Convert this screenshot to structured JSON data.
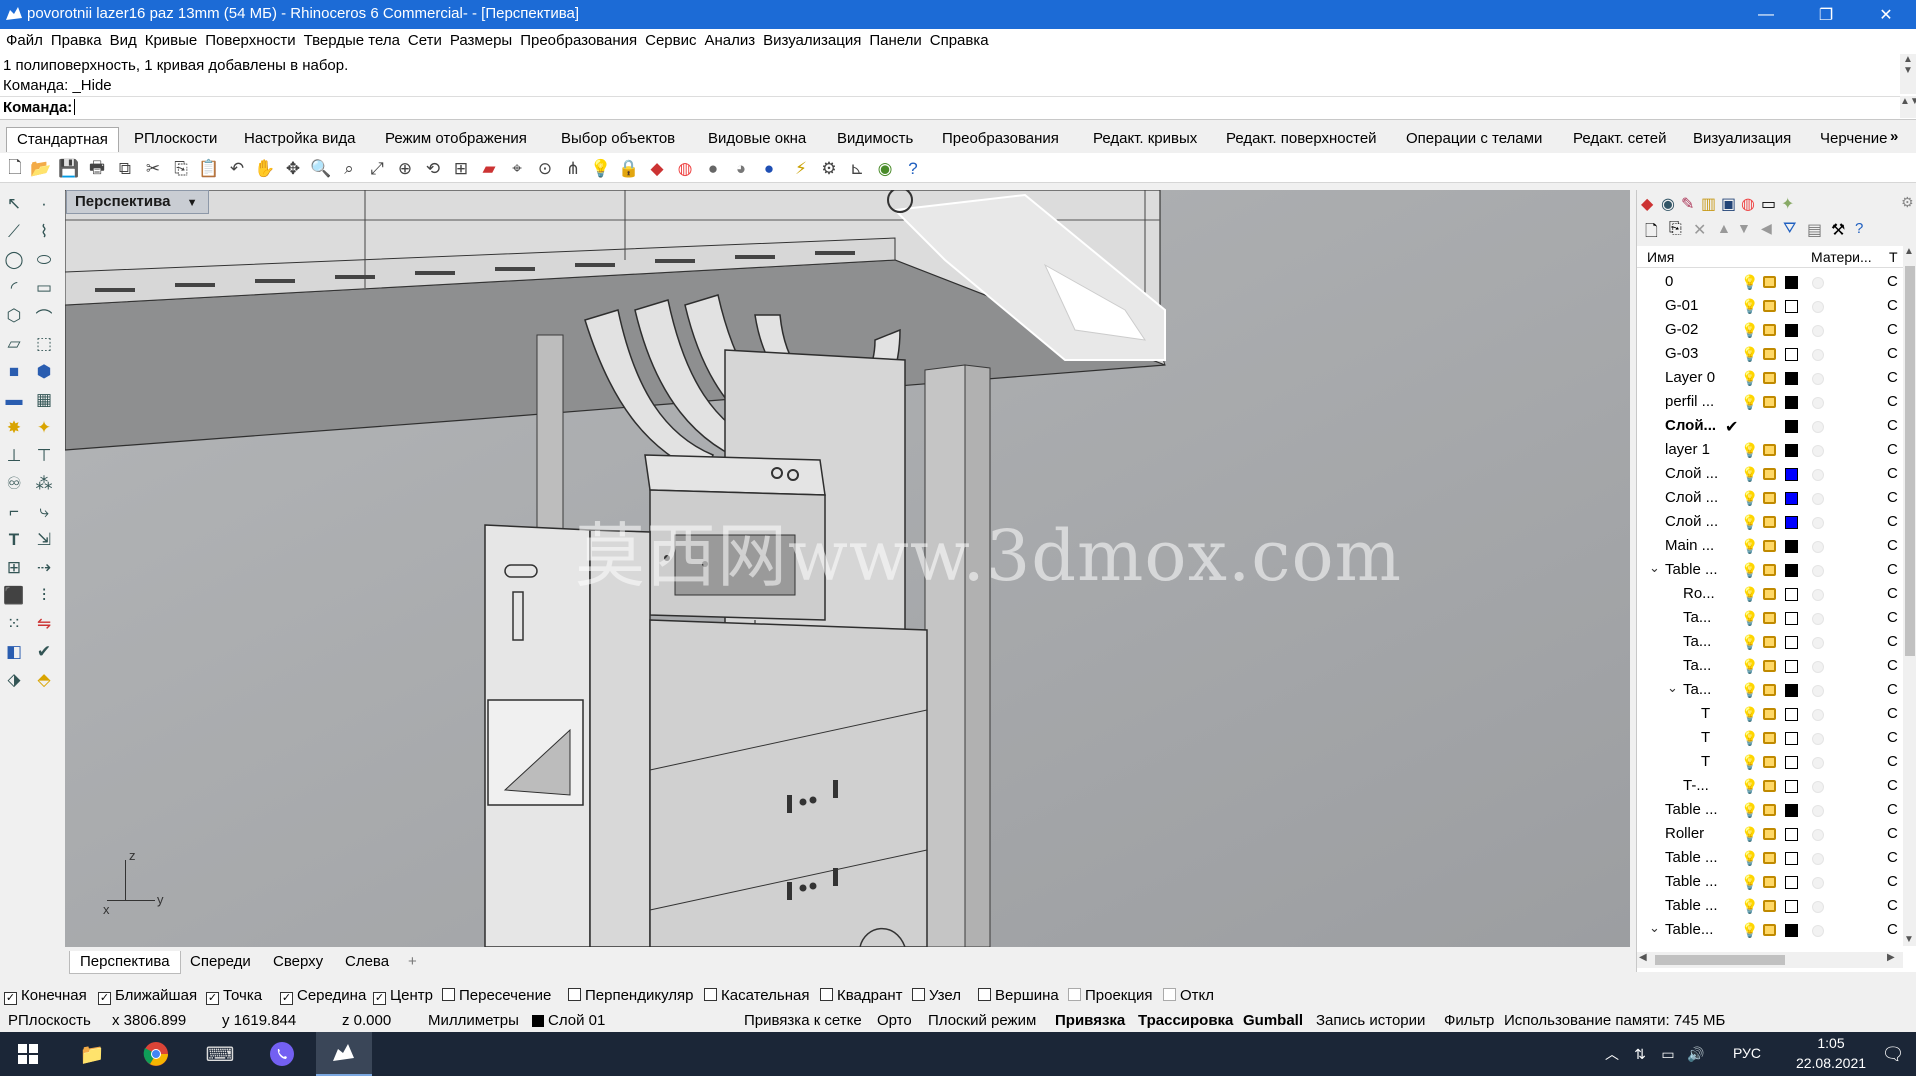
{
  "window": {
    "title": "povorotnii lazer16 paz 13mm (54 МБ) - Rhinoceros 6 Commercial- - [Перспектива]",
    "minimize_glyph": "—",
    "maximize_glyph": "❐",
    "close_glyph": "✕"
  },
  "menu": [
    "Файл",
    "Правка",
    "Вид",
    "Кривые",
    "Поверхности",
    "Твердые тела",
    "Сети",
    "Размеры",
    "Преобразования",
    "Сервис",
    "Анализ",
    "Визуализация",
    "Панели",
    "Справка"
  ],
  "command": {
    "history_1": "1 полиповерхность, 1 кривая добавлены в набор.",
    "history_2": "Команда: _Hide",
    "prompt_label": "Команда:",
    "input_value": ""
  },
  "toolbar_tabs": [
    "Стандартная",
    "РПлоскости",
    "Настройка вида",
    "Режим отображения",
    "Выбор объектов",
    "Видовые окна",
    "Видимость",
    "Преобразования",
    "Редакт. кривых",
    "Редакт. поверхностей",
    "Операции с телами",
    "Редакт. сетей",
    "Визуализация",
    "Черчение"
  ],
  "toolbar_overflow": "»",
  "viewport": {
    "title": "Перспектива",
    "axis_z": "z",
    "axis_x": "x",
    "axis_y": "y",
    "watermark": "莫西网www.3dmox.com"
  },
  "viewport_tabs": [
    "Перспектива",
    "Спереди",
    "Сверху",
    "Слева"
  ],
  "viewport_tab_add": "+",
  "layers": {
    "col_name": "Имя",
    "col_material": "Матери...",
    "col_t": "Т",
    "rows": [
      {
        "name": "0",
        "indent": 0,
        "color": "#000000",
        "current": false
      },
      {
        "name": "G-01",
        "indent": 0,
        "color": "#ffffff",
        "current": false
      },
      {
        "name": "G-02",
        "indent": 0,
        "color": "#000000",
        "current": false
      },
      {
        "name": "G-03",
        "indent": 0,
        "color": "#ffffff",
        "current": false
      },
      {
        "name": "Layer 0",
        "indent": 0,
        "color": "#000000",
        "current": false
      },
      {
        "name": "perfil ...",
        "indent": 0,
        "color": "#000000",
        "current": false
      },
      {
        "name": "Слой...",
        "indent": 0,
        "color": "#000000",
        "current": true
      },
      {
        "name": "layer 1",
        "indent": 0,
        "color": "#000000",
        "current": false
      },
      {
        "name": "Слой ...",
        "indent": 0,
        "color": "#0000ff",
        "current": false
      },
      {
        "name": "Слой ...",
        "indent": 0,
        "color": "#0000ff",
        "current": false
      },
      {
        "name": "Слой ...",
        "indent": 0,
        "color": "#0000ff",
        "current": false
      },
      {
        "name": "Main ...",
        "indent": 0,
        "color": "#000000",
        "current": false
      },
      {
        "name": "Table ...",
        "indent": 0,
        "color": "#000000",
        "current": false,
        "expanded": true
      },
      {
        "name": "Ro...",
        "indent": 1,
        "color": "#ffffff",
        "current": false
      },
      {
        "name": "Ta...",
        "indent": 1,
        "color": "#ffffff",
        "current": false
      },
      {
        "name": "Ta...",
        "indent": 1,
        "color": "#ffffff",
        "current": false
      },
      {
        "name": "Ta...",
        "indent": 1,
        "color": "#ffffff",
        "current": false
      },
      {
        "name": "Ta...",
        "indent": 1,
        "color": "#000000",
        "current": false,
        "expanded": true
      },
      {
        "name": "T",
        "indent": 2,
        "color": "#ffffff",
        "current": false
      },
      {
        "name": "T",
        "indent": 2,
        "color": "#ffffff",
        "current": false
      },
      {
        "name": "T",
        "indent": 2,
        "color": "#ffffff",
        "current": false
      },
      {
        "name": "T-...",
        "indent": 1,
        "color": "#ffffff",
        "current": false
      },
      {
        "name": "Table ...",
        "indent": 0,
        "color": "#000000",
        "current": false
      },
      {
        "name": "Roller",
        "indent": 0,
        "color": "#ffffff",
        "current": false
      },
      {
        "name": "Table ...",
        "indent": 0,
        "color": "#ffffff",
        "current": false
      },
      {
        "name": "Table ...",
        "indent": 0,
        "color": "#ffffff",
        "current": false
      },
      {
        "name": "Table ...",
        "indent": 0,
        "color": "#ffffff",
        "current": false
      },
      {
        "name": "Table...",
        "indent": 0,
        "color": "#000000",
        "current": false,
        "expanded": true
      }
    ],
    "t_value": "С"
  },
  "osnaps": [
    {
      "label": "Конечная",
      "checked": true
    },
    {
      "label": "Ближайшая",
      "checked": true
    },
    {
      "label": "Точка",
      "checked": true
    },
    {
      "label": "Середина",
      "checked": true
    },
    {
      "label": "Центр",
      "checked": true
    },
    {
      "label": "Пересечение",
      "checked": false
    },
    {
      "label": "Перпендикуляр",
      "checked": false
    },
    {
      "label": "Касательная",
      "checked": false
    },
    {
      "label": "Квадрант",
      "checked": false
    },
    {
      "label": "Узел",
      "checked": false
    },
    {
      "label": "Вершина",
      "checked": false
    },
    {
      "label": "Проекция",
      "checked": false
    },
    {
      "label": "Откл",
      "checked": false
    }
  ],
  "status": {
    "cplane": "РПлоскость",
    "x": "x 3806.899",
    "y": "y 1619.844",
    "z": "z 0.000",
    "units": "Миллиметры",
    "layer": "Слой 01",
    "grid_snap": "Привязка к сетке",
    "ortho": "Орто",
    "planar": "Плоский режим",
    "osnap": "Привязка",
    "smarttrack": "Трассировка",
    "gumball": "Gumball",
    "history": "Запись истории",
    "filter": "Фильтр",
    "memory": "Использование памяти: 745 МБ"
  },
  "taskbar": {
    "lang": "РУС",
    "time": "1:05",
    "date": "22.08.2021"
  }
}
